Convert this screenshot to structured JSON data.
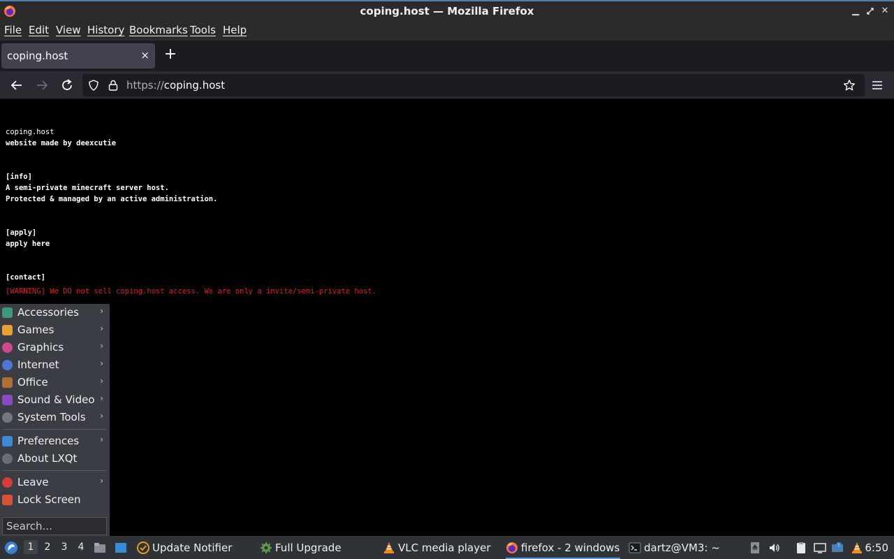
{
  "window": {
    "title": "coping.host — Mozilla Firefox"
  },
  "menubar": {
    "items": [
      "File",
      "Edit",
      "View",
      "History",
      "Bookmarks",
      "Tools",
      "Help"
    ]
  },
  "tabs": {
    "active_title": "coping.host",
    "close_glyph": "×",
    "new_tab_glyph": "+"
  },
  "urlbar": {
    "scheme": "https://",
    "host": "coping.host"
  },
  "page": {
    "site_name": "coping.host",
    "credit": "website made by deexcutie",
    "info_heading": "[info]",
    "info_line1": "A semi-private minecraft server host.",
    "info_line2": "Protected & managed by an active administration.",
    "apply_heading": "[apply]",
    "apply_link": "apply here",
    "contact_heading": "[contact]",
    "warning": "[WARNING] We DO not sell coping.host access. We are only a invite/semi-private host."
  },
  "app_menu": {
    "items": [
      {
        "label": "Accessories",
        "icon": "accessories-icon",
        "color": "#3a9a7a",
        "submenu": true
      },
      {
        "label": "Games",
        "icon": "games-icon",
        "color": "#e8a030",
        "submenu": true
      },
      {
        "label": "Graphics",
        "icon": "graphics-icon",
        "color": "#d04890",
        "submenu": true
      },
      {
        "label": "Internet",
        "icon": "internet-icon",
        "color": "#4a78d8",
        "submenu": true
      },
      {
        "label": "Office",
        "icon": "office-icon",
        "color": "#b07030",
        "submenu": true
      },
      {
        "label": "Sound & Video",
        "icon": "sound-video-icon",
        "color": "#8a48c8",
        "submenu": true
      },
      {
        "label": "System Tools",
        "icon": "system-tools-icon",
        "color": "#707880",
        "submenu": true
      },
      {
        "label": "Preferences",
        "icon": "preferences-icon",
        "color": "#3a8ad8",
        "submenu": true
      },
      {
        "label": "About LXQt",
        "icon": "info-icon",
        "color": "#6a6e74",
        "submenu": false
      },
      {
        "label": "Leave",
        "icon": "power-icon",
        "color": "#d83a3a",
        "submenu": true
      },
      {
        "label": "Lock Screen",
        "icon": "lock-icon",
        "color": "#e05030",
        "submenu": false
      }
    ],
    "arrow_glyph": "›",
    "search_placeholder": "Search..."
  },
  "taskbar": {
    "workspaces": [
      "1",
      "2",
      "3",
      "4"
    ],
    "active_workspace": "1",
    "tasks": [
      {
        "label": "Update Notifier",
        "icon": "update-notifier-icon"
      },
      {
        "label": "Full Upgrade",
        "icon": "gear-icon"
      },
      {
        "label": "VLC media player",
        "icon": "vlc-icon"
      },
      {
        "label": "firefox - 2 windows",
        "icon": "firefox-icon"
      },
      {
        "label": "dartz@VM3: ~",
        "icon": "terminal-icon"
      }
    ],
    "clock": "6:50"
  }
}
